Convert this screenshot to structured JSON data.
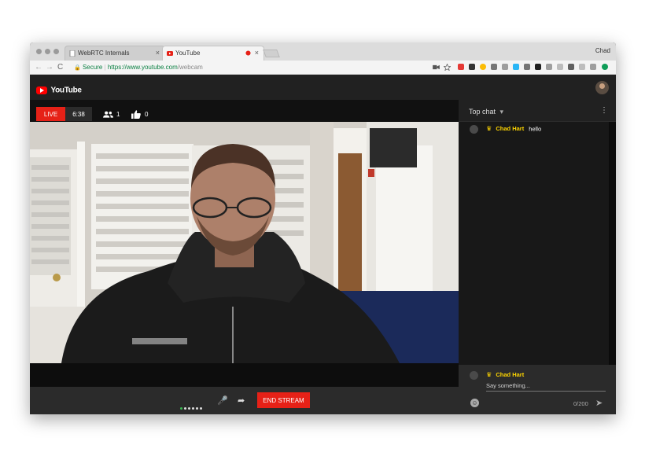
{
  "browser": {
    "profile_name": "Chad",
    "tabs": [
      {
        "title": "WebRTC Internals",
        "close": "×"
      },
      {
        "title": "YouTube",
        "close": "×"
      }
    ],
    "address": {
      "lock": "🔒",
      "secure_label": "Secure",
      "separator": "|",
      "scheme_host": "https://www.youtube.com",
      "path": "/webcam"
    },
    "nav": {
      "back": "←",
      "forward": "→",
      "reload": "C"
    }
  },
  "youtube": {
    "brand": "YouTube",
    "stream": {
      "live_label": "LIVE",
      "elapsed": "6:38",
      "viewers": "1",
      "likes": "0"
    },
    "controls": {
      "end_stream_label": "END STREAM",
      "mic": "🎤",
      "share": "➦"
    },
    "chat": {
      "title": "Top chat",
      "caret": "▾",
      "menu": "⋮",
      "messages": [
        {
          "author": "Chad Hart",
          "text": "hello"
        }
      ],
      "composer": {
        "author": "Chad Hart",
        "placeholder": "Say something...",
        "counter": "0/200",
        "send": "➤",
        "emoji": "☺"
      }
    }
  },
  "colors": {
    "brand_red": "#e62117",
    "owner_gold": "#ffd600",
    "secure_green": "#0b8043"
  }
}
